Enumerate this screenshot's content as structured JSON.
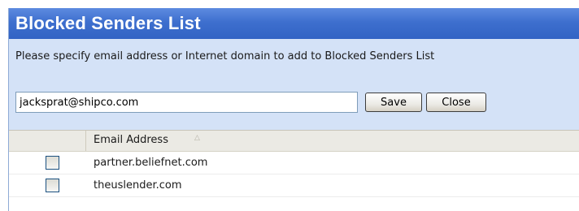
{
  "panel": {
    "title": "Blocked Senders List",
    "instruction": "Please specify email address or Internet domain to add to Blocked Senders List",
    "email_input": {
      "value": "jacksprat@shipco.com",
      "placeholder": ""
    },
    "buttons": {
      "save_label": "Save",
      "close_label": "Close"
    }
  },
  "table": {
    "columns": [
      "",
      "Email Address"
    ],
    "sort": {
      "column": "Email Address",
      "direction": "ascending",
      "icon": "sort-ascending-icon"
    },
    "rows": [
      {
        "checked": false,
        "email": "partner.beliefnet.com"
      },
      {
        "checked": false,
        "email": "theuslender.com"
      }
    ]
  },
  "colors": {
    "header_bg": "#3e6fce",
    "header_text": "#ffffff",
    "panel_bg": "#d4e2f7",
    "table_header_bg": "#ebeae4"
  }
}
